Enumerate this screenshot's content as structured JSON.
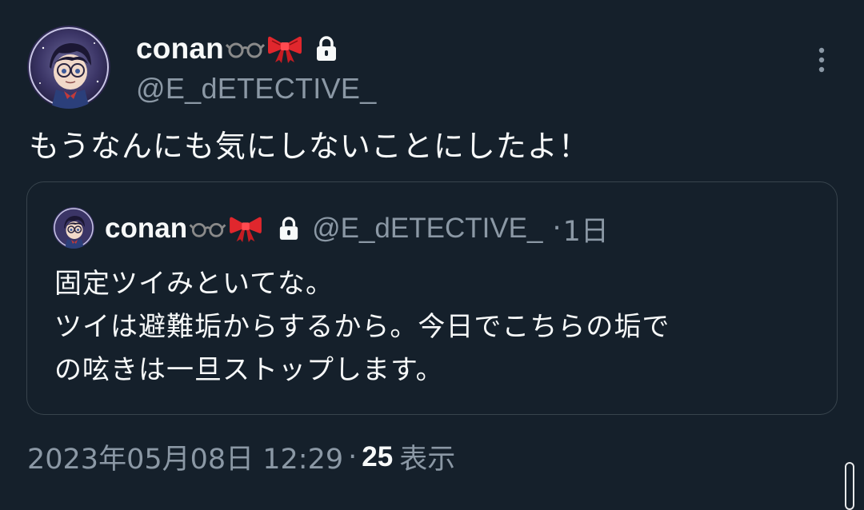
{
  "tweet": {
    "author": {
      "display_name": "conan",
      "emoji": [
        "glasses-icon",
        "ribbon-icon"
      ],
      "handle": "@E_dETECTIVE_",
      "protected": true
    },
    "text": "もうなんにも気にしないことにしたよ！",
    "quoted": {
      "display_name": "conan",
      "handle": "@E_dETECTIVE_",
      "separator": "·",
      "time": "1日",
      "text": "固定ツイみといてな。\nツイは避難垢からするから。今日でこちらの垢で\nの呟きは一旦ストップします。"
    },
    "meta": {
      "datetime": "2023年05月08日 12:29",
      "separator": "·",
      "views_count": "25",
      "views_label": "表示"
    }
  },
  "colors": {
    "background": "#15202b",
    "text_primary": "#f7f9f9",
    "text_secondary": "#8b98a5",
    "quote_border": "#38444d"
  }
}
